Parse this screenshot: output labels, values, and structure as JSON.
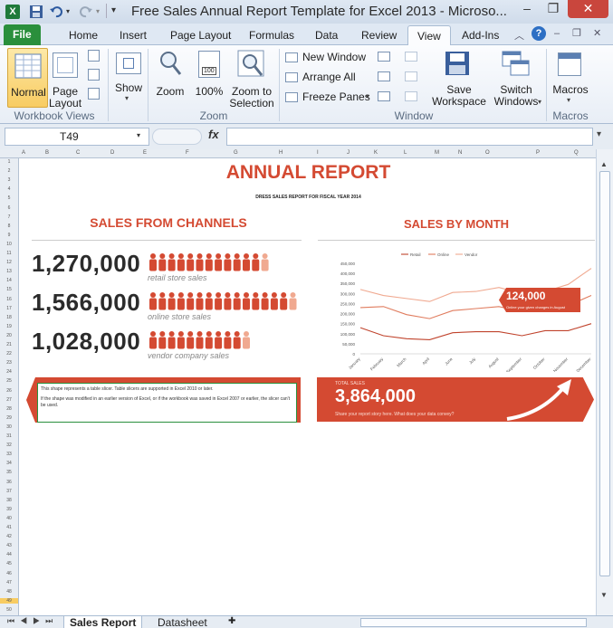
{
  "window": {
    "title": "Free Sales Annual Report Template for Excel 2013  -  Microso...",
    "app_icon": "excel-icon",
    "minimize": "–",
    "restore": "❐",
    "close": "✕"
  },
  "ribbon_tabs": [
    "File",
    "Home",
    "Insert",
    "Page Layout",
    "Formulas",
    "Data",
    "Review",
    "View",
    "Add-Ins"
  ],
  "active_tab": "View",
  "ribbon": {
    "workbook_views": {
      "label": "Workbook Views",
      "normal": "Normal",
      "page_layout_1": "Page",
      "page_layout_2": "Layout"
    },
    "show": {
      "label": "Show"
    },
    "zoom": {
      "label": "Zoom",
      "zoom": "Zoom",
      "zoom100": "100%",
      "zoom_sel_1": "Zoom to",
      "zoom_sel_2": "Selection",
      "badge": "100"
    },
    "window": {
      "label": "Window",
      "new_window": "New Window",
      "arrange_all": "Arrange All",
      "freeze_panes": "Freeze Panes",
      "save_ws_1": "Save",
      "save_ws_2": "Workspace",
      "switch_1": "Switch",
      "switch_2": "Windows"
    },
    "macros": {
      "label": "Macros",
      "macros": "Macros"
    }
  },
  "formula_bar": {
    "name_box": "T49",
    "fx": "fx",
    "value": ""
  },
  "columns": [
    "A",
    "B",
    "C",
    "D",
    "E",
    "F",
    "G",
    "H",
    "I",
    "J",
    "K",
    "L",
    "M",
    "N",
    "O",
    "P",
    "Q"
  ],
  "rows": [
    "1",
    "2",
    "3",
    "4",
    "5",
    "6",
    "7",
    "8",
    "9",
    "10",
    "11",
    "12",
    "13",
    "14",
    "15",
    "16",
    "17",
    "18",
    "19",
    "20",
    "21",
    "22",
    "23",
    "24",
    "25",
    "26",
    "27",
    "28",
    "29",
    "30",
    "31",
    "32",
    "33",
    "34",
    "35",
    "36",
    "37",
    "38",
    "39",
    "40",
    "41",
    "42",
    "43",
    "44",
    "45",
    "46",
    "47",
    "48",
    "49",
    "50"
  ],
  "report": {
    "title": "ANNUAL REPORT",
    "subtitle": "DRESS SALES REPORT FOR FISCAL YEAR 2014",
    "channels_heading": "SALES FROM CHANNELS",
    "month_heading": "SALES BY MONTH",
    "channels": [
      {
        "value": "1,270,000",
        "caption": "retail store sales",
        "icons": "12.5"
      },
      {
        "value": "1,566,000",
        "caption": "online store sales",
        "icons": "15.5"
      },
      {
        "value": "1,028,000",
        "caption": "vendor company sales",
        "icons": "10.5"
      }
    ],
    "slicer_note_1": "This shape represents a table slicer. Table slicers are supported in Excel 2010 or later.",
    "slicer_note_2": "If the shape was modified in an earlier version of Excel, or if the workbook was saved in Excel 2007 or earlier, the slicer can't be used.",
    "callout_value": "124,000",
    "callout_text": "Online your given changes in August",
    "total_label": "TOTAL SALES",
    "total_value": "3,864,000",
    "total_text": "Share your report story here. What does your data convey?"
  },
  "sheet_tabs": [
    "Sales Report",
    "Datasheet"
  ],
  "active_sheet": "Sales Report",
  "colors": {
    "accent": "#d44a32",
    "file_tab": "#2a8f3c",
    "retail": "#c0432c",
    "online": "#e07c5e",
    "vendor": "#f0a990"
  },
  "chart_data": {
    "type": "line",
    "categories": [
      "January",
      "February",
      "March",
      "April",
      "June",
      "July",
      "August",
      "September",
      "October",
      "November",
      "December"
    ],
    "series": [
      {
        "name": "Retail",
        "values": [
          130000,
          90000,
          75000,
          70000,
          105000,
          110000,
          110000,
          90000,
          115000,
          115000,
          150000
        ]
      },
      {
        "name": "Online",
        "values": [
          230000,
          235000,
          195000,
          175000,
          215000,
          225000,
          235000,
          210000,
          225000,
          240000,
          290000
        ]
      },
      {
        "name": "Vendor",
        "values": [
          320000,
          290000,
          275000,
          260000,
          305000,
          310000,
          330000,
          300000,
          310000,
          345000,
          425000
        ]
      }
    ],
    "yticks": [
      "450,000",
      "400,000",
      "350,000",
      "300,000",
      "250,000",
      "200,000",
      "150,000",
      "100,000",
      "50,000",
      "0"
    ],
    "ylim": [
      0,
      450000
    ],
    "legend": "top",
    "grid": false
  }
}
